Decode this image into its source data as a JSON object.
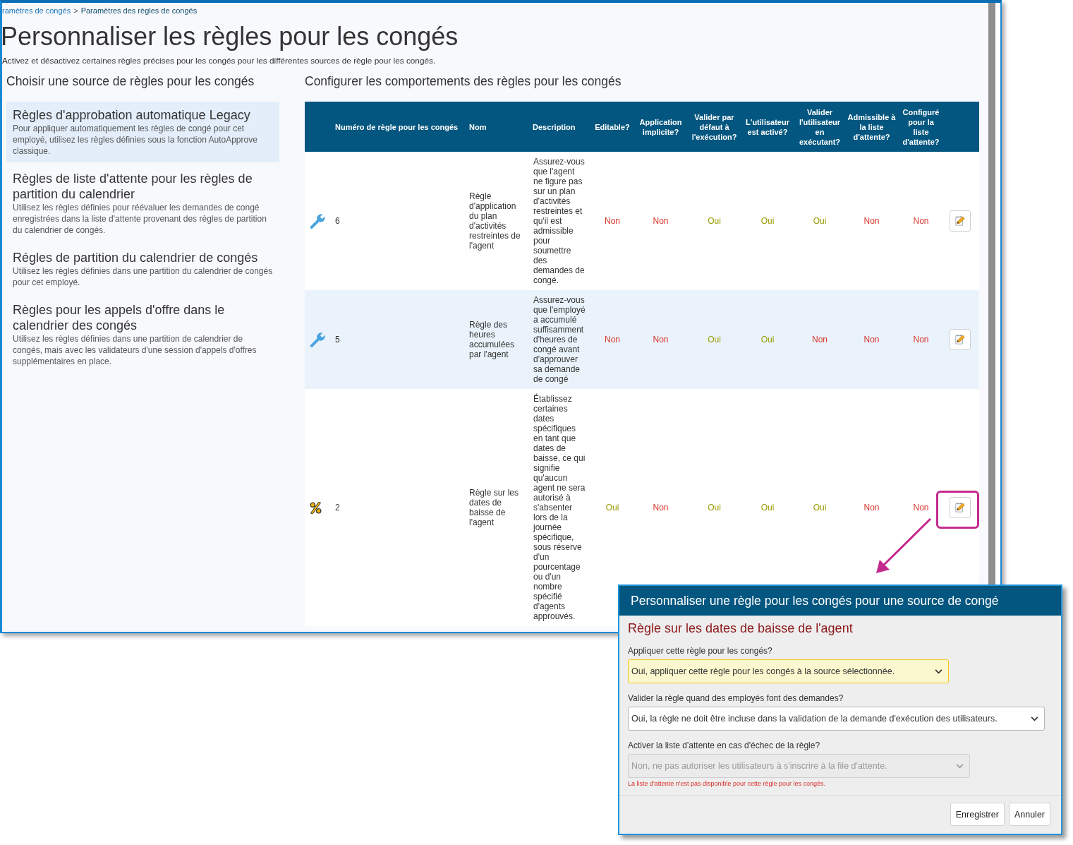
{
  "breadcrumb": {
    "items": [
      {
        "label": "ramètres de congés",
        "kind": "link"
      },
      {
        "label": "Paramètres des règles de congés",
        "kind": "current"
      }
    ],
    "separator": ">"
  },
  "page_title": "Personnaliser les règles pour les congés",
  "page_subtitle": "Activez et désactivez certaines règles précises pour les congés pour les différentes sources de règle pour les congés.",
  "sources": {
    "heading": "Choisir une source de règles pour les congés",
    "items": [
      {
        "title": "Règles d'approbation automatique Legacy",
        "description": "Pour appliquer automatiquement les règles de congé pour cet employé, utilisez les règles définies sous la fonction AutoApprove classique.",
        "selected": true
      },
      {
        "title": "Règles de liste d'attente pour les règles de partition du calendrier",
        "description": "Utilisez les règles définies pour réévaluer les demandes de congé enregistrées dans la liste d'attente provenant des règles de partition du calendrier de congés.",
        "selected": false
      },
      {
        "title": "Régles de partition du calendrier de congés",
        "description": "Utilisez les règles définies dans une partition du calendrier de congés pour cet employé.",
        "selected": false
      },
      {
        "title": "Règles pour les appels d'offre dans le calendrier des congés",
        "description": "Utilisez les règles définies dans une partition de calendrier de congés, mais avec les validateurs d'une session d'appels d'offres supplémentaires en place.",
        "selected": false
      }
    ]
  },
  "rules": {
    "heading": "Configurer les comportements des règles pour les congés",
    "columns": [
      "Numéro de règle pour les congés",
      "Nom",
      "Description",
      "Editable?",
      "Application implicite?",
      "Valider par défaut à l'exécution?",
      "L'utilisateur est activé?",
      "Valider l'utilisateur en exécutant?",
      "Admissible à la liste d'attente?",
      "Configuré pour la liste d'attente?"
    ],
    "rows": [
      {
        "kind": "tool",
        "number": "6",
        "name": "Règle d'application du plan d'activités restreintes de l'agent",
        "description": "Assurez-vous que l'agent ne figure pas sur un plan d'activités restreintes et qu'il est admissible pour soumettre des demandes de congé.",
        "flags": [
          {
            "text": "Non",
            "on": false
          },
          {
            "text": "Non",
            "on": false
          },
          {
            "text": "Oui",
            "on": true
          },
          {
            "text": "Oui",
            "on": true
          },
          {
            "text": "Oui",
            "on": true
          },
          {
            "text": "Non",
            "on": false
          },
          {
            "text": "Non",
            "on": false
          }
        ],
        "highlighted": false
      },
      {
        "kind": "tool",
        "number": "5",
        "name": "Règle des heures accumulées par l'agent",
        "description": "Assurez-vous que l'employé a accumulé suffisamment d'heures de congé avant d'approuver sa demande de congé",
        "flags": [
          {
            "text": "Non",
            "on": false
          },
          {
            "text": "Non",
            "on": false
          },
          {
            "text": "Oui",
            "on": true
          },
          {
            "text": "Oui",
            "on": true
          },
          {
            "text": "Non",
            "on": false
          },
          {
            "text": "Non",
            "on": false
          },
          {
            "text": "Non",
            "on": false
          }
        ],
        "highlighted": false
      },
      {
        "kind": "percent",
        "number": "2",
        "name": "Règle sur les dates de baisse de l'agent",
        "description": "Établissez certaines dates spécifiques en tant que dates de baisse, ce qui signifie qu'aucun agent ne sera autorisé à s'absenter lors de la journée spécifique, sous réserve d'un pourcentage ou d'un nombre spécifié d'agents approuvés.",
        "flags": [
          {
            "text": "Oui",
            "on": true
          },
          {
            "text": "Non",
            "on": false
          },
          {
            "text": "Oui",
            "on": true
          },
          {
            "text": "Oui",
            "on": true
          },
          {
            "text": "Oui",
            "on": true
          },
          {
            "text": "Non",
            "on": false
          },
          {
            "text": "Non",
            "on": false
          }
        ],
        "highlighted": true
      }
    ]
  },
  "dialog": {
    "title": "Personnaliser une règle pour les congés pour une source de congé",
    "rule_name": "Règle sur les dates de baisse de l'agent",
    "fields": [
      {
        "label": "Appliquer cette règle pour les congés?",
        "value": "Oui, appliquer cette règle pour les congés à la source sélectionnée.",
        "modified": true,
        "disabled": false
      },
      {
        "label": "Valider la règle quand des employés font des demandes?",
        "value": "Oui, la règle ne doit être incluse dans la validation de la demande d'exécution des utilisateurs.",
        "modified": false,
        "disabled": false
      },
      {
        "label": "Activer la liste d'attente en cas d'échec de la règle?",
        "value": "Non, ne pas autoriser les utilisateurs à s'inscrire à la file d'attente.",
        "modified": false,
        "disabled": true,
        "note": "La liste d'attente n'est pas disponible pour cette règle pour les congés."
      }
    ],
    "buttons": [
      "Enregistrer",
      "Annuler"
    ]
  }
}
